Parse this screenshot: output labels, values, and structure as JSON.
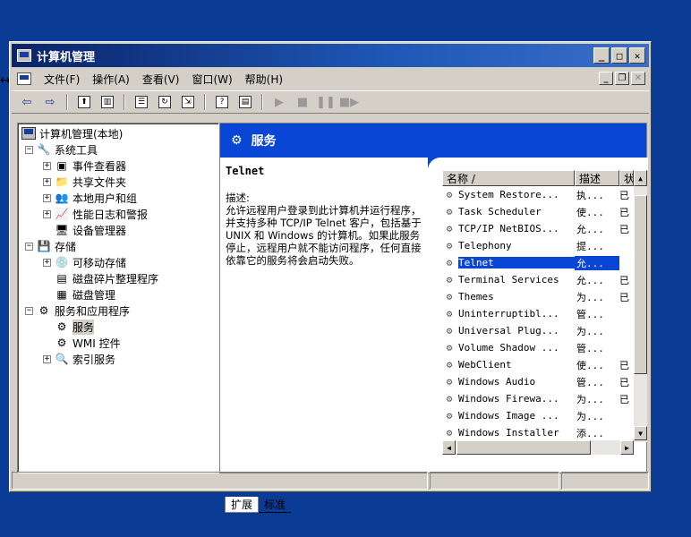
{
  "window": {
    "title": "计算机管理"
  },
  "menu": [
    "文件(F)",
    "操作(A)",
    "查看(V)",
    "窗口(W)",
    "帮助(H)"
  ],
  "tree": {
    "root": "计算机管理(本地)",
    "items": [
      {
        "label": "系统工具",
        "level": 1,
        "expander": "−",
        "icon": "tools-icon",
        "glyph": "🔧"
      },
      {
        "label": "事件查看器",
        "level": 2,
        "expander": "+",
        "icon": "event-viewer-icon",
        "glyph": "▣"
      },
      {
        "label": "共享文件夹",
        "level": 2,
        "expander": "+",
        "icon": "shared-folder-icon",
        "glyph": "📁"
      },
      {
        "label": "本地用户和组",
        "level": 2,
        "expander": "+",
        "icon": "users-icon",
        "glyph": "👥"
      },
      {
        "label": "性能日志和警报",
        "level": 2,
        "expander": "+",
        "icon": "performance-icon",
        "glyph": "📈"
      },
      {
        "label": "设备管理器",
        "level": 2,
        "expander": "",
        "icon": "device-manager-icon",
        "glyph": "🖥"
      },
      {
        "label": "存储",
        "level": 1,
        "expander": "−",
        "icon": "storage-icon",
        "glyph": "💾"
      },
      {
        "label": "可移动存储",
        "level": 2,
        "expander": "+",
        "icon": "removable-storage-icon",
        "glyph": "💿"
      },
      {
        "label": "磁盘碎片整理程序",
        "level": 2,
        "expander": "",
        "icon": "defrag-icon",
        "glyph": "▤"
      },
      {
        "label": "磁盘管理",
        "level": 2,
        "expander": "",
        "icon": "disk-management-icon",
        "glyph": "▦"
      },
      {
        "label": "服务和应用程序",
        "level": 1,
        "expander": "−",
        "icon": "services-apps-icon",
        "glyph": "⚙"
      },
      {
        "label": "服务",
        "level": 2,
        "expander": "",
        "icon": "services-icon",
        "glyph": "⚙",
        "selected": true
      },
      {
        "label": "WMI 控件",
        "level": 2,
        "expander": "",
        "icon": "wmi-icon",
        "glyph": "⚙"
      },
      {
        "label": "索引服务",
        "level": 2,
        "expander": "+",
        "icon": "index-service-icon",
        "glyph": "🔍"
      }
    ]
  },
  "detail": {
    "header": "服务",
    "service_name": "Telnet",
    "desc_label": "描述:",
    "desc_text": "允许远程用户登录到此计算机并运行程序，并支持多种 TCP/IP Telnet 客户，包括基于 UNIX 和 Windows 的计算机。如果此服务停止，远程用户就不能访问程序，任何直接依靠它的服务将会启动失败。"
  },
  "list": {
    "columns": [
      "名称 /",
      "描述",
      "状"
    ],
    "rows": [
      {
        "name": "System Restore...",
        "desc": "执...",
        "status": "已"
      },
      {
        "name": "Task Scheduler",
        "desc": "使...",
        "status": "已"
      },
      {
        "name": "TCP/IP NetBIOS...",
        "desc": "允...",
        "status": "已"
      },
      {
        "name": "Telephony",
        "desc": "提...",
        "status": ""
      },
      {
        "name": "Telnet",
        "desc": "允...",
        "status": "",
        "selected": true
      },
      {
        "name": "Terminal Services",
        "desc": "允...",
        "status": "已"
      },
      {
        "name": "Themes",
        "desc": "为...",
        "status": "已"
      },
      {
        "name": "Uninterruptibl...",
        "desc": "管...",
        "status": ""
      },
      {
        "name": "Universal Plug...",
        "desc": "为...",
        "status": ""
      },
      {
        "name": "Volume Shadow ...",
        "desc": "管...",
        "status": ""
      },
      {
        "name": "WebClient",
        "desc": "使...",
        "status": "已"
      },
      {
        "name": "Windows Audio",
        "desc": "管...",
        "status": "已"
      },
      {
        "name": "Windows Firewa...",
        "desc": "为...",
        "status": "已"
      },
      {
        "name": "Windows Image ...",
        "desc": "为...",
        "status": ""
      },
      {
        "name": "Windows Installer",
        "desc": "添...",
        "status": ""
      }
    ]
  },
  "tabs": [
    "扩展",
    "标准"
  ]
}
